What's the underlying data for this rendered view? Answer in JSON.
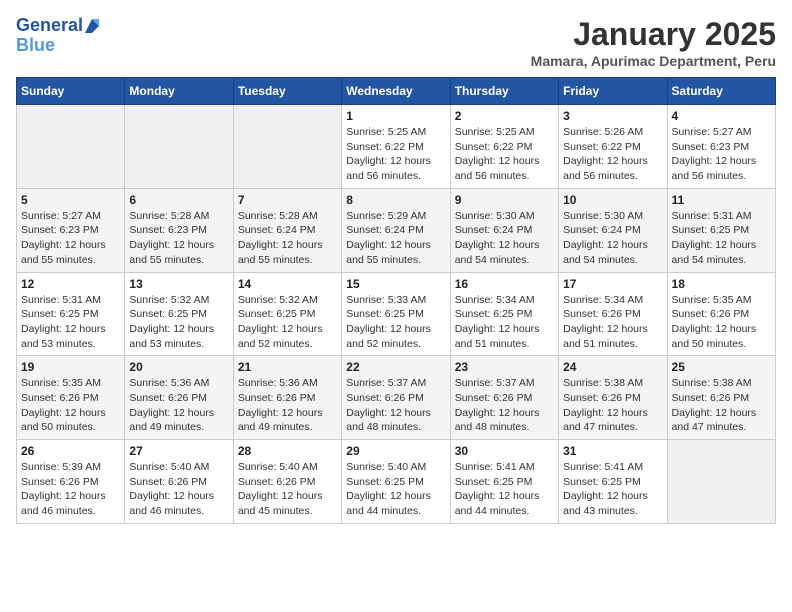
{
  "logo": {
    "line1": "General",
    "line2": "Blue"
  },
  "title": "January 2025",
  "subtitle": "Mamara, Apurimac Department, Peru",
  "days_of_week": [
    "Sunday",
    "Monday",
    "Tuesday",
    "Wednesday",
    "Thursday",
    "Friday",
    "Saturday"
  ],
  "weeks": [
    [
      {
        "day": "",
        "info": ""
      },
      {
        "day": "",
        "info": ""
      },
      {
        "day": "",
        "info": ""
      },
      {
        "day": "1",
        "info": "Sunrise: 5:25 AM\nSunset: 6:22 PM\nDaylight: 12 hours and 56 minutes."
      },
      {
        "day": "2",
        "info": "Sunrise: 5:25 AM\nSunset: 6:22 PM\nDaylight: 12 hours and 56 minutes."
      },
      {
        "day": "3",
        "info": "Sunrise: 5:26 AM\nSunset: 6:22 PM\nDaylight: 12 hours and 56 minutes."
      },
      {
        "day": "4",
        "info": "Sunrise: 5:27 AM\nSunset: 6:23 PM\nDaylight: 12 hours and 56 minutes."
      }
    ],
    [
      {
        "day": "5",
        "info": "Sunrise: 5:27 AM\nSunset: 6:23 PM\nDaylight: 12 hours and 55 minutes."
      },
      {
        "day": "6",
        "info": "Sunrise: 5:28 AM\nSunset: 6:23 PM\nDaylight: 12 hours and 55 minutes."
      },
      {
        "day": "7",
        "info": "Sunrise: 5:28 AM\nSunset: 6:24 PM\nDaylight: 12 hours and 55 minutes."
      },
      {
        "day": "8",
        "info": "Sunrise: 5:29 AM\nSunset: 6:24 PM\nDaylight: 12 hours and 55 minutes."
      },
      {
        "day": "9",
        "info": "Sunrise: 5:30 AM\nSunset: 6:24 PM\nDaylight: 12 hours and 54 minutes."
      },
      {
        "day": "10",
        "info": "Sunrise: 5:30 AM\nSunset: 6:24 PM\nDaylight: 12 hours and 54 minutes."
      },
      {
        "day": "11",
        "info": "Sunrise: 5:31 AM\nSunset: 6:25 PM\nDaylight: 12 hours and 54 minutes."
      }
    ],
    [
      {
        "day": "12",
        "info": "Sunrise: 5:31 AM\nSunset: 6:25 PM\nDaylight: 12 hours and 53 minutes."
      },
      {
        "day": "13",
        "info": "Sunrise: 5:32 AM\nSunset: 6:25 PM\nDaylight: 12 hours and 53 minutes."
      },
      {
        "day": "14",
        "info": "Sunrise: 5:32 AM\nSunset: 6:25 PM\nDaylight: 12 hours and 52 minutes."
      },
      {
        "day": "15",
        "info": "Sunrise: 5:33 AM\nSunset: 6:25 PM\nDaylight: 12 hours and 52 minutes."
      },
      {
        "day": "16",
        "info": "Sunrise: 5:34 AM\nSunset: 6:25 PM\nDaylight: 12 hours and 51 minutes."
      },
      {
        "day": "17",
        "info": "Sunrise: 5:34 AM\nSunset: 6:26 PM\nDaylight: 12 hours and 51 minutes."
      },
      {
        "day": "18",
        "info": "Sunrise: 5:35 AM\nSunset: 6:26 PM\nDaylight: 12 hours and 50 minutes."
      }
    ],
    [
      {
        "day": "19",
        "info": "Sunrise: 5:35 AM\nSunset: 6:26 PM\nDaylight: 12 hours and 50 minutes."
      },
      {
        "day": "20",
        "info": "Sunrise: 5:36 AM\nSunset: 6:26 PM\nDaylight: 12 hours and 49 minutes."
      },
      {
        "day": "21",
        "info": "Sunrise: 5:36 AM\nSunset: 6:26 PM\nDaylight: 12 hours and 49 minutes."
      },
      {
        "day": "22",
        "info": "Sunrise: 5:37 AM\nSunset: 6:26 PM\nDaylight: 12 hours and 48 minutes."
      },
      {
        "day": "23",
        "info": "Sunrise: 5:37 AM\nSunset: 6:26 PM\nDaylight: 12 hours and 48 minutes."
      },
      {
        "day": "24",
        "info": "Sunrise: 5:38 AM\nSunset: 6:26 PM\nDaylight: 12 hours and 47 minutes."
      },
      {
        "day": "25",
        "info": "Sunrise: 5:38 AM\nSunset: 6:26 PM\nDaylight: 12 hours and 47 minutes."
      }
    ],
    [
      {
        "day": "26",
        "info": "Sunrise: 5:39 AM\nSunset: 6:26 PM\nDaylight: 12 hours and 46 minutes."
      },
      {
        "day": "27",
        "info": "Sunrise: 5:40 AM\nSunset: 6:26 PM\nDaylight: 12 hours and 46 minutes."
      },
      {
        "day": "28",
        "info": "Sunrise: 5:40 AM\nSunset: 6:26 PM\nDaylight: 12 hours and 45 minutes."
      },
      {
        "day": "29",
        "info": "Sunrise: 5:40 AM\nSunset: 6:25 PM\nDaylight: 12 hours and 44 minutes."
      },
      {
        "day": "30",
        "info": "Sunrise: 5:41 AM\nSunset: 6:25 PM\nDaylight: 12 hours and 44 minutes."
      },
      {
        "day": "31",
        "info": "Sunrise: 5:41 AM\nSunset: 6:25 PM\nDaylight: 12 hours and 43 minutes."
      },
      {
        "day": "",
        "info": ""
      }
    ]
  ]
}
